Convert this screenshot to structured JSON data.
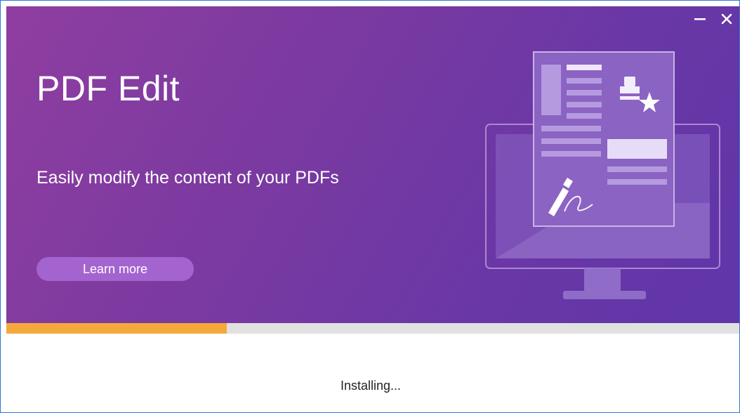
{
  "banner": {
    "title": "PDF Edit",
    "subtitle": "Easily modify the content of your PDFs",
    "learn_more_label": "Learn more"
  },
  "window_controls": {
    "minimize_icon": "minimize-icon",
    "close_icon": "close-icon"
  },
  "illustration": {
    "icon": "monitor-document-illustration"
  },
  "progress": {
    "fraction": 0.3,
    "color": "#f5a93a"
  },
  "status_text": "Installing..."
}
